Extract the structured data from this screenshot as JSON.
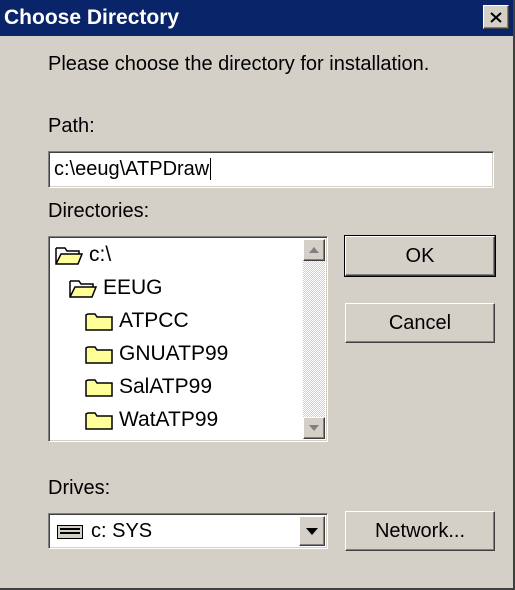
{
  "window": {
    "title": "Choose Directory"
  },
  "prompt": "Please choose the directory for installation.",
  "path": {
    "label": "Path:",
    "value": "c:\\eeug\\ATPDraw"
  },
  "directories": {
    "label": "Directories:",
    "items": [
      {
        "name": "c:\\",
        "icon": "open-folder-icon",
        "indent": 0
      },
      {
        "name": "EEUG",
        "icon": "open-folder-icon",
        "indent": 1
      },
      {
        "name": "ATPCC",
        "icon": "folder-icon",
        "indent": 2
      },
      {
        "name": "GNUATP99",
        "icon": "folder-icon",
        "indent": 2
      },
      {
        "name": "SalATP99",
        "icon": "folder-icon",
        "indent": 2
      },
      {
        "name": "WatATP99",
        "icon": "folder-icon",
        "indent": 2
      }
    ]
  },
  "drives": {
    "label": "Drives:",
    "value": "c: SYS"
  },
  "buttons": {
    "ok": "OK",
    "cancel": "Cancel",
    "network": "Network..."
  },
  "colors": {
    "titlebar": "#0a246a",
    "face": "#d4d0c8",
    "folder": "#ffff99"
  }
}
